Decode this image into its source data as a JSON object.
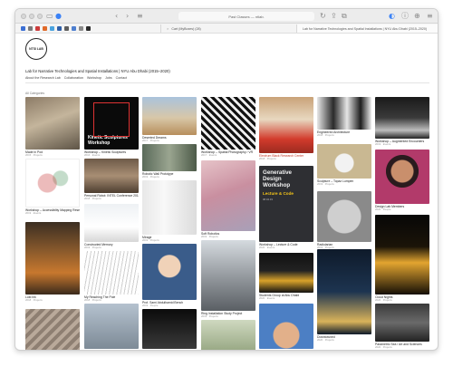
{
  "browser": {
    "address_text": "Past Classes — ntlab.",
    "tabs": [
      {
        "label": "Cart (MyBoxes) (28)"
      },
      {
        "label": "Lab for Narrative Technologies and Spatial Installations | NYU Abu Dhabi (2015–2020)"
      }
    ]
  },
  "site": {
    "logo_text": "NTSI LAB",
    "title": "Lab for Narrative Technologies and Spatial Installations | NYU Abu Dhabi (2015–2020)",
    "nav": [
      "About the Research Lab",
      "Collaboration",
      "Workshop",
      "Jobs",
      "Contact"
    ],
    "section_label": "All Categories"
  },
  "cards": [
    {
      "caption": "Made in Pod",
      "sub": "2015 · Projects"
    },
    {
      "caption": "Workshop – Kinetic Sculptures",
      "sub": "2016 · Events",
      "thumb_title": "Kinetic Sculptures Workshop"
    },
    {
      "caption": "Deserted Dreams",
      "sub": "2017 · Projects"
    },
    {
      "caption": "Workshop – Spatial Photography / VR",
      "sub": "2017 · Events"
    },
    {
      "caption": "Electrum Black Research Center",
      "sub": "2018 · Projects"
    },
    {
      "caption": "Engineered Architecture",
      "sub": "2018 · Projects"
    },
    {
      "caption": "Workshop – Augmented Encounters",
      "sub": "2019 · Events"
    },
    {
      "caption": "Workshop – Accessibility Mapping Research",
      "sub": "2019 · Events"
    },
    {
      "caption": "Pedestrian Paths",
      "sub": "2018 · Projects"
    },
    {
      "caption": "Robotic Wall Prototype",
      "sub": "2019 · Projects"
    },
    {
      "caption": "Sculpture – Topaz Lumpen",
      "sub": "2019 · Projects"
    },
    {
      "caption": "Design Lab Members",
      "sub": "2020 · People"
    },
    {
      "caption": "Personal Robot: INTEL Conference 2018",
      "sub": "2018 · Projects"
    },
    {
      "caption": "Mirage",
      "sub": "2019 · Projects"
    },
    {
      "caption": "Soft Robotics",
      "sub": "2019 · Projects"
    },
    {
      "caption": "Workshop – Lecture & Code",
      "sub": "2020 · Events",
      "thumb_title": "Generative Design Workshop",
      "thumb_sub": "Lecture & Code",
      "thumb_date": "08.04.19"
    },
    {
      "caption": "Radiolarian",
      "sub": "2019 · Projects"
    },
    {
      "caption": "Lost Ink",
      "sub": "2018 · Projects"
    },
    {
      "caption": "Constructed Memory",
      "sub": "2019 · Projects"
    },
    {
      "caption": "Cloud Nights",
      "sub": "2020 · Projects"
    },
    {
      "caption": "Prof. Sami Abdulhamid Bench",
      "sub": "2019 · People"
    },
    {
      "caption": "Night Lights",
      "sub": "2020 · Projects"
    },
    {
      "caption": "My Reaching The Pole",
      "sub": "2018 · Projects"
    },
    {
      "caption": "Ring Installation Study Project",
      "sub": "2019 · Projects"
    },
    {
      "caption": "Students Group at Abu Dhabi",
      "sub": "2020 · Events"
    },
    {
      "caption": "Downtowned",
      "sub": "2020 · Projects"
    },
    {
      "caption": "Parametric Sea / Art and Sciences",
      "sub": "2020 · Projects"
    },
    {
      "caption": "",
      "sub": ""
    },
    {
      "caption": "",
      "sub": ""
    },
    {
      "caption": "",
      "sub": ""
    },
    {
      "caption": "",
      "sub": ""
    }
  ]
}
